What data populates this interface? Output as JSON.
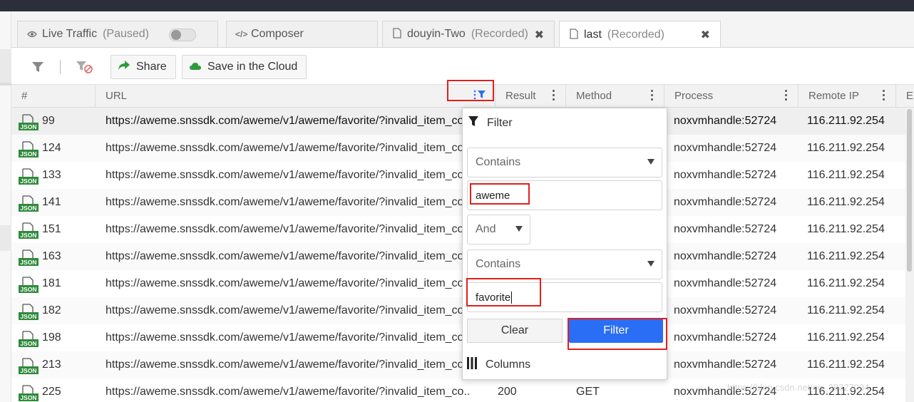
{
  "tabs": [
    {
      "icon": "eye-icon",
      "title": "Live Traffic",
      "status": "(Paused)",
      "has_toggle": true,
      "active": false
    },
    {
      "icon": "code-icon",
      "title": "Composer",
      "status": "",
      "active": false
    },
    {
      "icon": "document-icon",
      "title": "douyin-Two",
      "status": "(Recorded)",
      "close": "✖",
      "active": false
    },
    {
      "icon": "document-icon",
      "title": "last",
      "status": "(Recorded)",
      "close": "✖",
      "active": true
    }
  ],
  "toolbar": {
    "share_label": "Share",
    "save_cloud_label": "Save in the Cloud"
  },
  "columns": {
    "num": "#",
    "url": "URL",
    "result": "Result",
    "method": "Method",
    "process": "Process",
    "remote_ip": "Remote IP",
    "extra": "E"
  },
  "rows": [
    {
      "num": "99",
      "url": "https://aweme.snssdk.com/aweme/v1/aweme/favorite/?invalid_item_co",
      "result": "",
      "method": "",
      "process": "noxvmhandle:52724",
      "ip": "116.211.92.254"
    },
    {
      "num": "124",
      "url": "https://aweme.snssdk.com/aweme/v1/aweme/favorite/?invalid_item_co",
      "result": "",
      "method": "",
      "process": "noxvmhandle:52724",
      "ip": "116.211.92.254"
    },
    {
      "num": "133",
      "url": "https://aweme.snssdk.com/aweme/v1/aweme/favorite/?invalid_item_co",
      "result": "",
      "method": "",
      "process": "noxvmhandle:52724",
      "ip": "116.211.92.254"
    },
    {
      "num": "141",
      "url": "https://aweme.snssdk.com/aweme/v1/aweme/favorite/?invalid_item_co",
      "result": "",
      "method": "",
      "process": "noxvmhandle:52724",
      "ip": "116.211.92.254"
    },
    {
      "num": "151",
      "url": "https://aweme.snssdk.com/aweme/v1/aweme/favorite/?invalid_item_co",
      "result": "",
      "method": "",
      "process": "noxvmhandle:52724",
      "ip": "116.211.92.254"
    },
    {
      "num": "163",
      "url": "https://aweme.snssdk.com/aweme/v1/aweme/favorite/?invalid_item_co",
      "result": "",
      "method": "",
      "process": "noxvmhandle:52724",
      "ip": "116.211.92.254"
    },
    {
      "num": "181",
      "url": "https://aweme.snssdk.com/aweme/v1/aweme/favorite/?invalid_item_co",
      "result": "",
      "method": "",
      "process": "noxvmhandle:52724",
      "ip": "116.211.92.254"
    },
    {
      "num": "182",
      "url": "https://aweme.snssdk.com/aweme/v1/aweme/favorite/?invalid_item_co",
      "result": "",
      "method": "",
      "process": "noxvmhandle:52724",
      "ip": "116.211.92.254"
    },
    {
      "num": "198",
      "url": "https://aweme.snssdk.com/aweme/v1/aweme/favorite/?invalid_item_co",
      "result": "",
      "method": "",
      "process": "noxvmhandle:52724",
      "ip": "116.211.92.254"
    },
    {
      "num": "213",
      "url": "https://aweme.snssdk.com/aweme/v1/aweme/favorite/?invalid_item_co",
      "result": "",
      "method": "",
      "process": "noxvmhandle:52724",
      "ip": "116.211.92.254"
    },
    {
      "num": "225",
      "url": "https://aweme.snssdk.com/aweme/v1/aweme/favorite/?invalid_item_co...",
      "result": "200",
      "method": "GET",
      "process": "noxvmhandle:52724",
      "ip": "116.211.92.254"
    }
  ],
  "filter_popup": {
    "title": "Filter",
    "condition1": "Contains",
    "value1": "aweme",
    "operator": "And",
    "condition2": "Contains",
    "value2": "favorite",
    "clear_label": "Clear",
    "filter_label": "Filter",
    "columns_label": "Columns"
  },
  "watermark": "https://blog.csdn.net/qq_38327094",
  "colors": {
    "primary_button": "#2a6ef5",
    "json_badge": "#2e8b3a",
    "highlight_red": "#e0201e",
    "topbar": "#2b2f3a"
  }
}
